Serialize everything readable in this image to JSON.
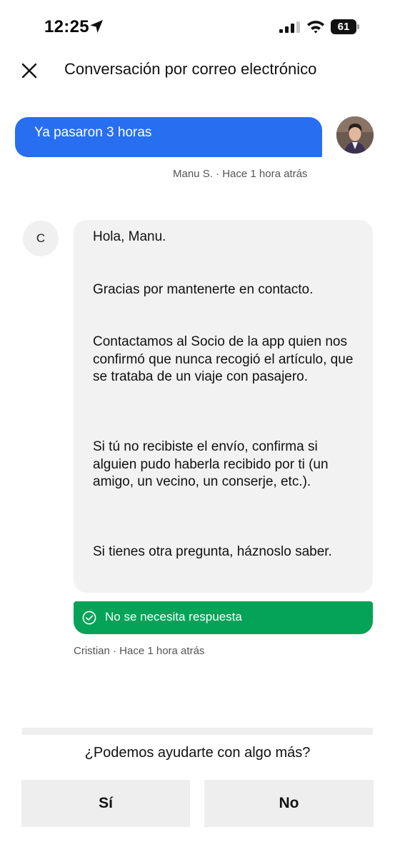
{
  "status_bar": {
    "time": "12:25",
    "battery": "61",
    "icons": [
      "location-arrow-icon",
      "cellular-signal-icon",
      "wifi-icon",
      "battery-icon"
    ]
  },
  "header": {
    "title": "Conversación por correo electrónico",
    "close_icon": "close-icon"
  },
  "outgoing_message": {
    "text": "Ya pasaron 3 horas",
    "meta": "Manu S. · Hace 1 hora atrás",
    "bubble_color": "#276ef1"
  },
  "incoming_message": {
    "avatar_initial": "C",
    "paragraphs": [
      "Hola, Manu.",
      "Gracias por mantenerte en contacto.",
      "Contactamos al Socio de la app quien nos confirmó que nunca recogió el artículo, que se trataba de un viaje con pasajero.",
      "Si tú no recibiste el envío, confirma si alguien pudo haberla recibido por ti (un amigo, un vecino, un conserje, etc.).",
      "Si tienes otra pregunta, háznoslo saber."
    ],
    "status": "No se necesita respuesta",
    "status_color": "#05a357",
    "meta": "Cristian  · Hace 1 hora atrás"
  },
  "footer": {
    "question": "¿Podemos ayudarte con algo más?",
    "yes_label": "Sí",
    "no_label": "No"
  }
}
